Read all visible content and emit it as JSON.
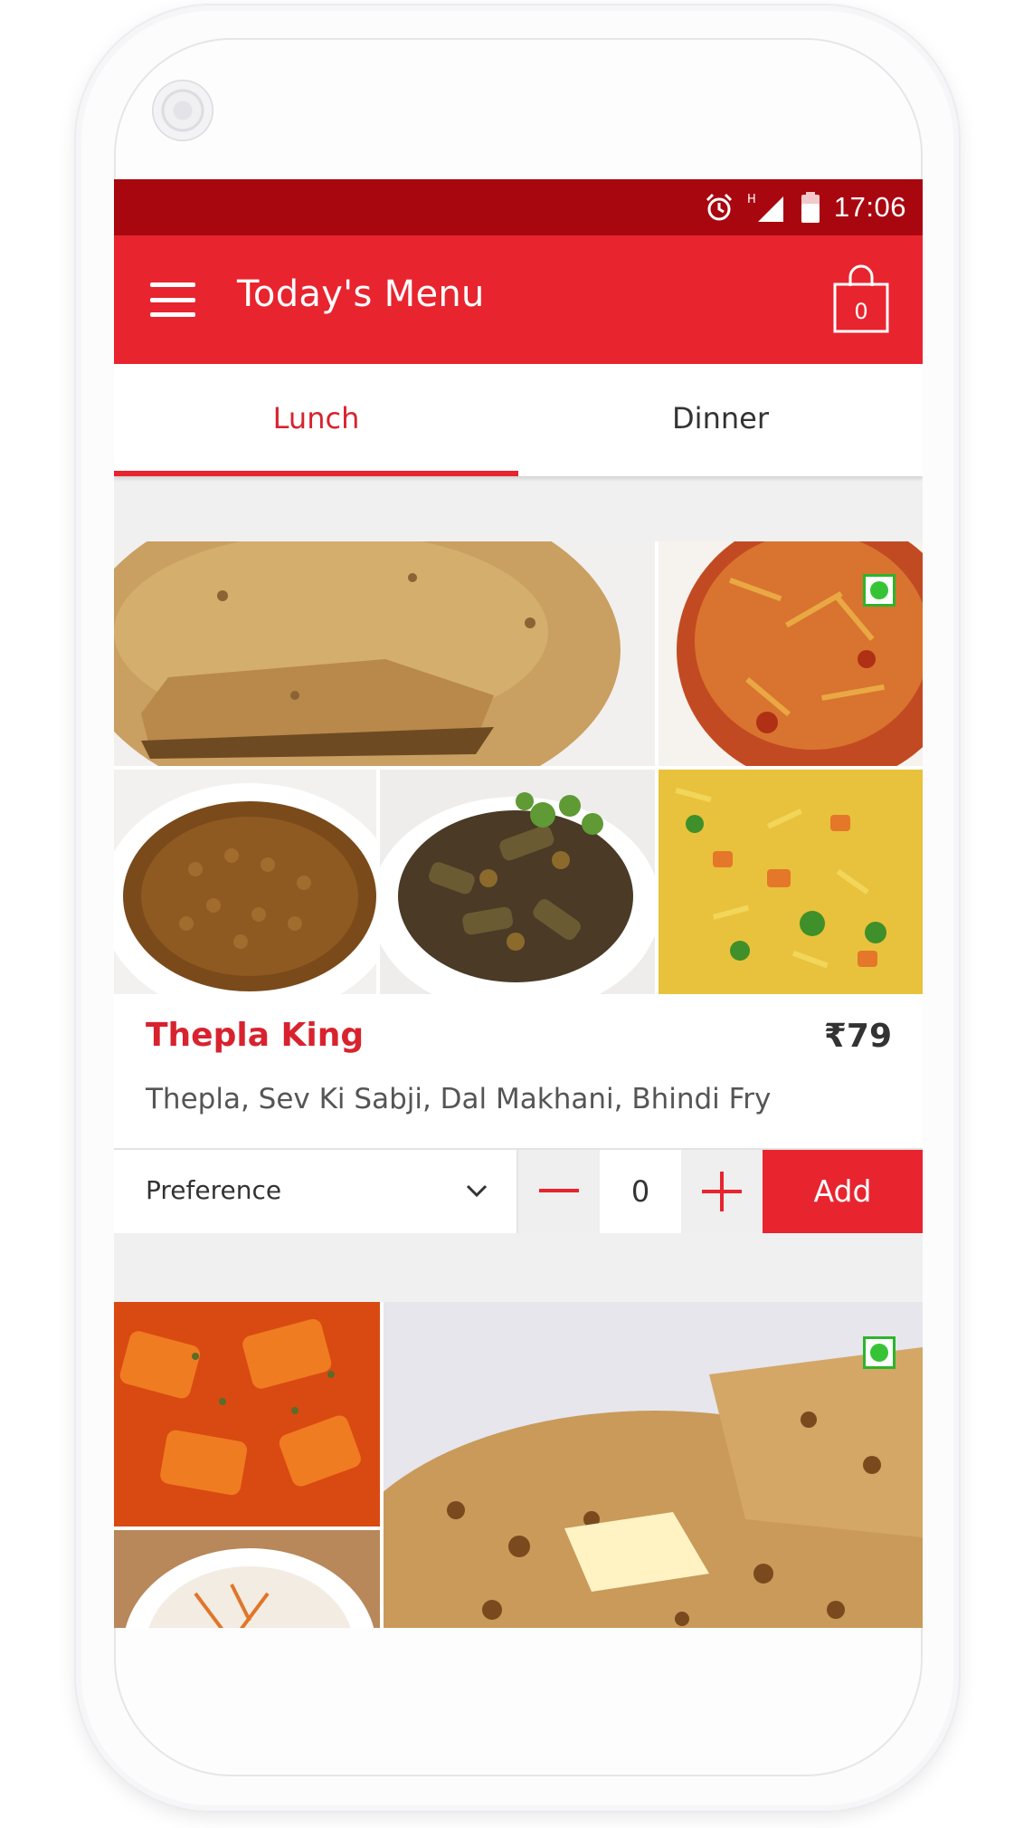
{
  "status_bar": {
    "time": "17:06",
    "icons": [
      "alarm-icon",
      "signal-icon",
      "battery-icon"
    ],
    "network_label": "H"
  },
  "app_bar": {
    "menu_icon": "hamburger-menu-icon",
    "title": "Today's Menu",
    "cart_count": "0",
    "cart_icon": "shopping-bag-icon"
  },
  "tabs": [
    {
      "label": "Lunch",
      "selected": true
    },
    {
      "label": "Dinner",
      "selected": false
    }
  ],
  "items": [
    {
      "name": "Thepla King",
      "price": "₹79",
      "description": "Thepla, Sev Ki Sabji, Dal Makhani, Bhindi Fry",
      "veg": true,
      "images": [
        "thepla-image",
        "sev-sabji-image",
        "dal-image",
        "bhindi-fry-image",
        "pulao-image"
      ],
      "preference_label": "Preference",
      "quantity": "0",
      "add_label": "Add"
    },
    {
      "veg": true,
      "images": [
        "paneer-curry-image",
        "raita-image",
        "paratha-image"
      ]
    }
  ],
  "colors": {
    "primary": "#e8242f",
    "status_bar": "#a8070f",
    "veg": "#36c436"
  }
}
